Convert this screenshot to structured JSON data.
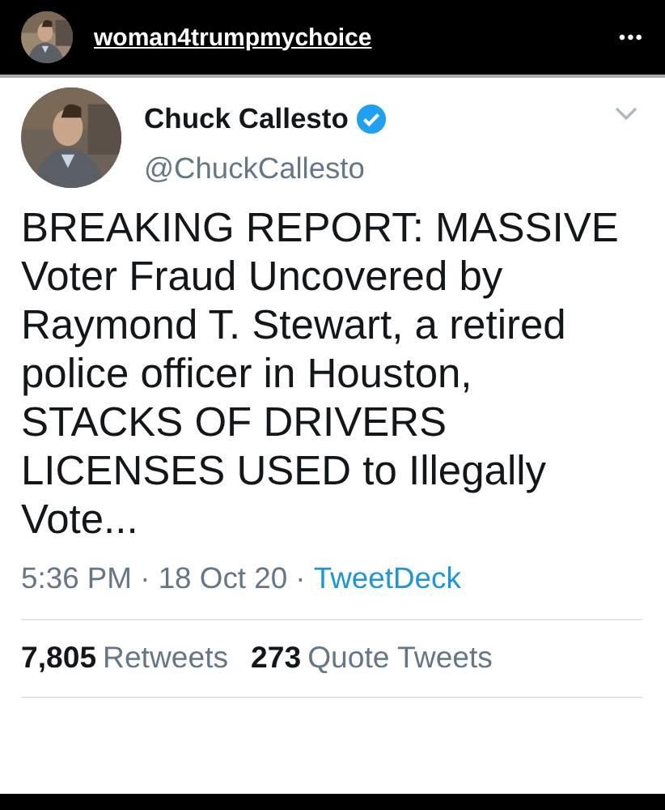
{
  "post_header": {
    "username": "woman4trumpmychoice",
    "menu": "•••"
  },
  "tweet": {
    "author": {
      "name": "Chuck Callesto",
      "verified": true,
      "handle": "@ChuckCallesto"
    },
    "text": "BREAKING REPORT: MASSIVE Voter Fraud Uncovered by Raymond T. Stewart, a retired police officer in Houston, STACKS OF DRIVERS LICENSES USED to Illegally Vote...",
    "time": "5:36 PM · 18 Oct 20 · ",
    "source": "TweetDeck",
    "stats": [
      {
        "count": "7,805",
        "label": "Retweets"
      },
      {
        "count": "273",
        "label": "Quote Tweets"
      }
    ]
  }
}
